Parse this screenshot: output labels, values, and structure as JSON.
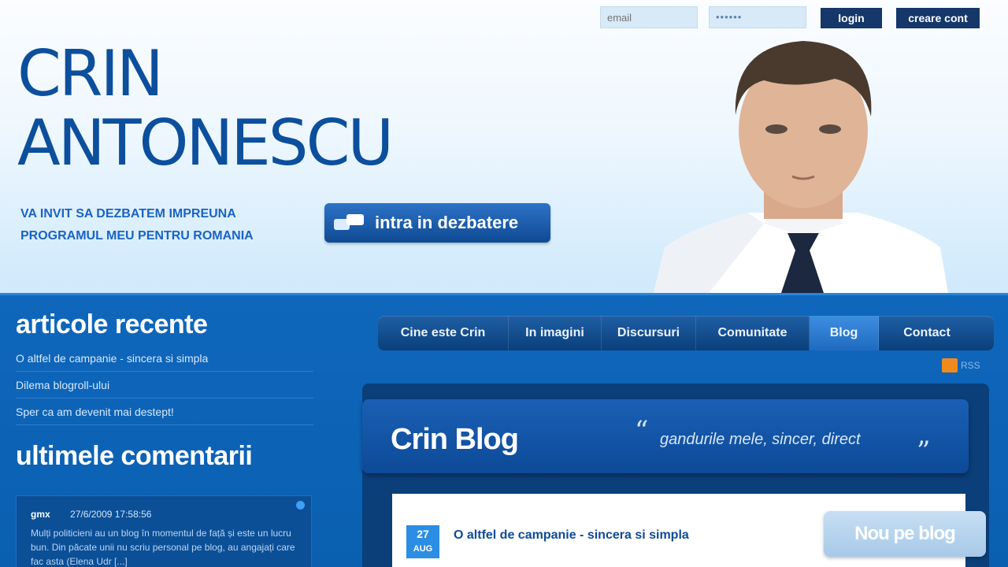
{
  "login": {
    "email_placeholder": "email",
    "password_value": "••••••",
    "login_label": "login",
    "signup_label": "creare cont"
  },
  "brand": {
    "line1": "CRIN",
    "line2": "ANTONESCU"
  },
  "invite": {
    "line1": "VA INVIT SA DEZBATEM IMPREUNA",
    "line2": "PROGRAMUL MEU PENTRU ROMANIA",
    "button_label": "intra in dezbatere"
  },
  "sidebar": {
    "recent_heading": "articole recente",
    "recent": [
      "O altfel de campanie - sincera si simpla",
      "Dilema blogroll-ului",
      "Sper ca am devenit mai destept!"
    ],
    "comments_heading": "ultimele comentarii",
    "comment": {
      "author": "gmx",
      "date": "27/6/2009 17:58:56",
      "text": "Mulți politicieni au un blog în momentul de față și este un lucru bun. Din păcate unii nu scriu personal pe blog, au angajați care fac asta (Elena Udr [...]"
    }
  },
  "nav": {
    "items": [
      "Cine este Crin",
      "In imagini",
      "Discursuri",
      "Comunitate",
      "Blog",
      "Contact"
    ],
    "active": "Blog"
  },
  "rss_label": "RSS",
  "blog": {
    "title": "Crin Blog",
    "tagline": "gandurile mele, sincer, direct",
    "post": {
      "day": "27",
      "month": "AUG",
      "title": "O altfel de campanie - sincera si simpla"
    },
    "new_label": "Nou pe blog"
  },
  "colors": {
    "brand": "#0c4f9c",
    "accent": "#0a63b6",
    "nav_active": "#3e8ee0"
  }
}
